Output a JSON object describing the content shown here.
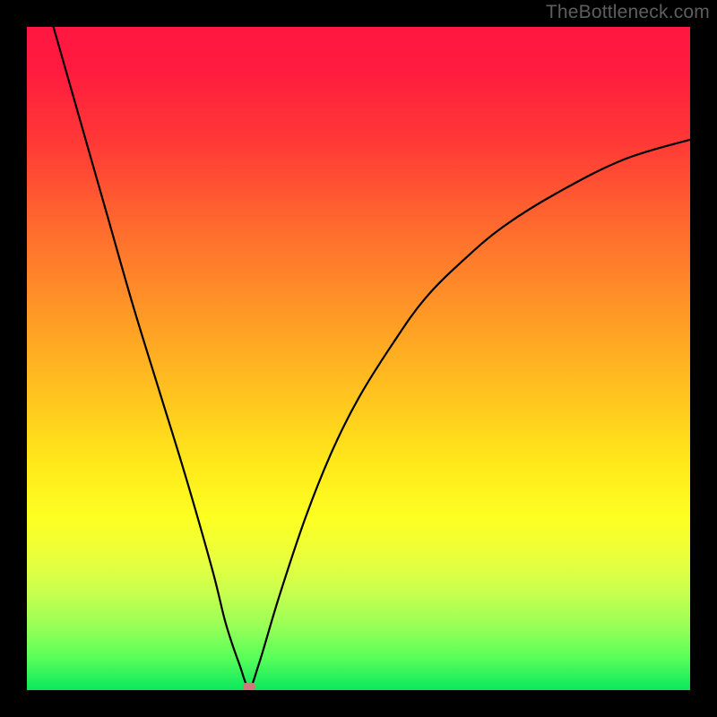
{
  "watermark": "TheBottleneck.com",
  "chart_data": {
    "type": "line",
    "title": "",
    "xlabel": "",
    "ylabel": "",
    "xlim": [
      0,
      100
    ],
    "ylim": [
      0,
      100
    ],
    "grid": false,
    "series": [
      {
        "name": "bottleneck-curve",
        "x": [
          4,
          8,
          12,
          16,
          20,
          24,
          28,
          30,
          32,
          33.5,
          35,
          38,
          42,
          46,
          50,
          55,
          60,
          66,
          72,
          80,
          90,
          100
        ],
        "values": [
          100,
          86,
          72,
          58,
          45,
          32,
          18,
          10,
          4,
          0.5,
          4,
          14,
          26,
          36,
          44,
          52,
          59,
          65,
          70,
          75,
          80,
          83
        ]
      }
    ],
    "annotations": [
      {
        "name": "minimum-marker",
        "x": 33.5,
        "y": 0.5,
        "color": "#cf7b7b"
      }
    ],
    "background_gradient": {
      "stops": [
        {
          "pos": 0,
          "color": "#ff1740"
        },
        {
          "pos": 18,
          "color": "#ff3b36"
        },
        {
          "pos": 42,
          "color": "#ff9427"
        },
        {
          "pos": 66,
          "color": "#ffe91a"
        },
        {
          "pos": 85,
          "color": "#caff4e"
        },
        {
          "pos": 100,
          "color": "#0ae85d"
        }
      ]
    }
  }
}
